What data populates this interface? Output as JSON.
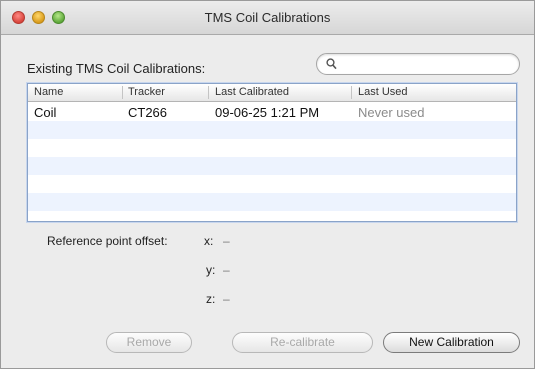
{
  "window": {
    "title": "TMS Coil Calibrations"
  },
  "list": {
    "section_label": "Existing TMS Coil Calibrations:",
    "search": {
      "value": "",
      "placeholder": ""
    },
    "columns": [
      "Name",
      "Tracker",
      "Last Calibrated",
      "Last Used"
    ],
    "rows": [
      {
        "name": "Coil",
        "tracker": "CT266",
        "last_calibrated": "09-06-25 1:21 PM",
        "last_used": "Never used"
      }
    ]
  },
  "offset": {
    "label": "Reference point offset:",
    "x_label": "x:",
    "x_value": "–",
    "y_label": "y:",
    "y_value": "–",
    "z_label": "z:",
    "z_value": "–"
  },
  "buttons": {
    "remove": "Remove",
    "recalibrate": "Re-calibrate",
    "new_calibration": "New Calibration"
  },
  "colors": {
    "selection_alt_row": "#edf3fe",
    "table_border": "#8aa3c8"
  }
}
